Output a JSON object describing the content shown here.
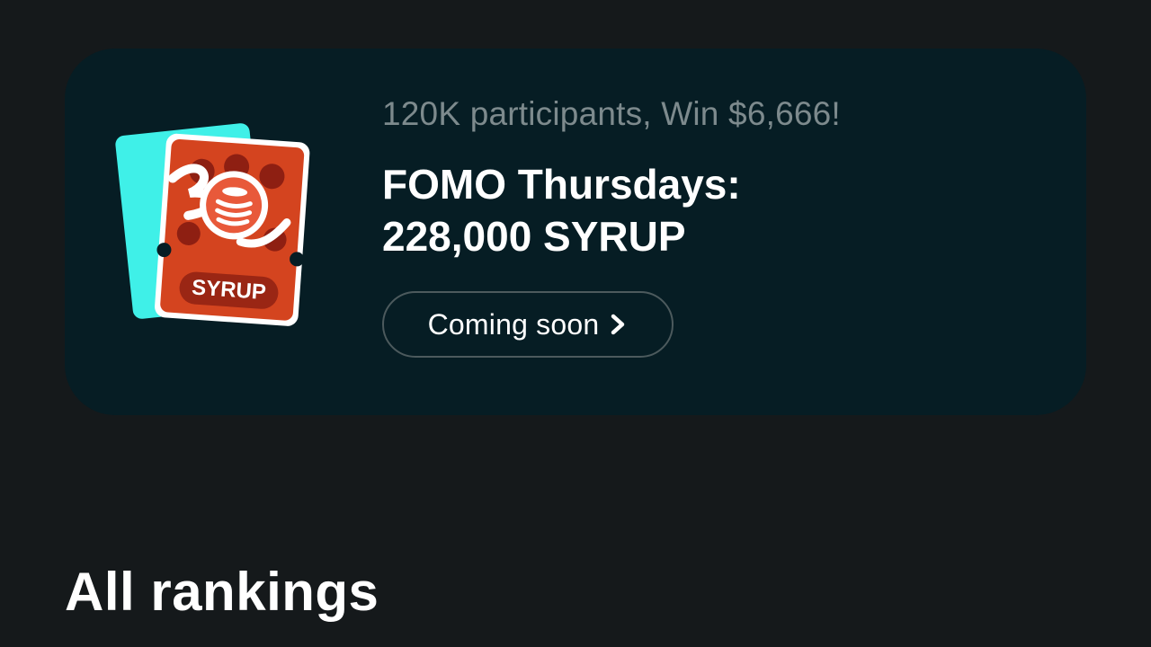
{
  "promo": {
    "subtitle": "120K participants, Win $6,666!",
    "title_line1": "FOMO Thursdays:",
    "title_line2": "228,000 SYRUP",
    "button_label": "Coming soon",
    "button_icon": "chevron-right-icon",
    "badge_label": "SYRUP",
    "ticket_icon": "ticket-icon",
    "colors": {
      "card_bg": "#061d24",
      "ticket_red": "#d4441f",
      "ticket_cyan": "#3ff0e8"
    }
  },
  "section": {
    "title": "All rankings"
  }
}
